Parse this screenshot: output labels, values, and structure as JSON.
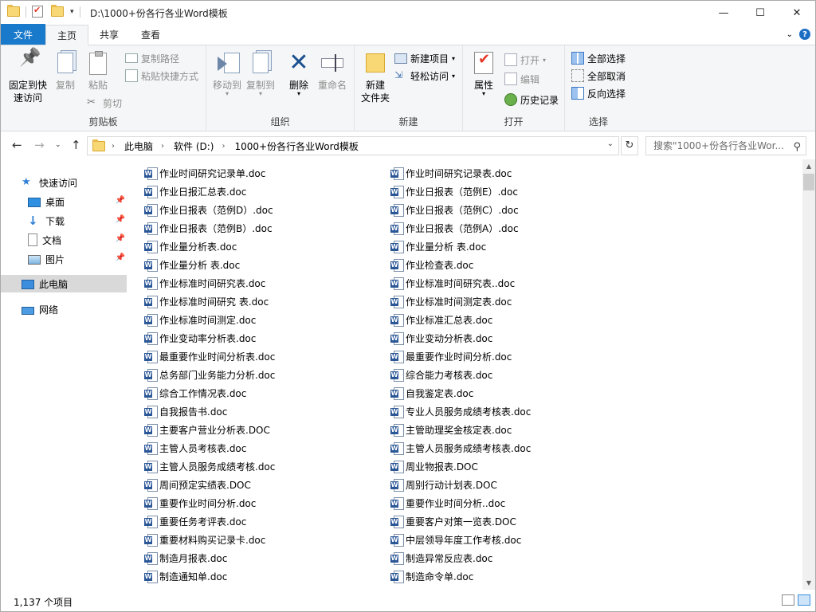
{
  "window": {
    "title": "D:\\1000+份各行各业Word模板",
    "controls": {
      "minimize": "—",
      "maximize": "☐",
      "close": "✕"
    }
  },
  "ribbon_tabs": [
    "文件",
    "主页",
    "共享",
    "查看"
  ],
  "ribbon": {
    "clipboard": {
      "label": "剪贴板",
      "pin": "固定到快\n速访问",
      "pin_l1": "固定到快",
      "pin_l2": "速访问",
      "copy": "复制",
      "paste": "粘贴",
      "copy_path": "复制路径",
      "paste_shortcut": "粘贴快捷方式",
      "cut": "剪切"
    },
    "organize": {
      "label": "组织",
      "move_to": "移动到",
      "copy_to": "复制到",
      "delete": "删除",
      "rename": "重命名"
    },
    "new": {
      "label": "新建",
      "new_folder_l1": "新建",
      "new_folder_l2": "文件夹",
      "new_item": "新建项目",
      "easy_access": "轻松访问"
    },
    "open": {
      "label": "打开",
      "properties": "属性",
      "open": "打开",
      "edit": "编辑",
      "history": "历史记录"
    },
    "select": {
      "label": "选择",
      "select_all": "全部选择",
      "select_none": "全部取消",
      "invert": "反向选择"
    }
  },
  "address": {
    "crumbs": [
      "此电脑",
      "软件 (D:)",
      "1000+份各行各业Word模板"
    ],
    "search_placeholder": "搜索\"1000+份各行各业Wor..."
  },
  "nav_pane": {
    "quick_access": "快速访问",
    "desktop": "桌面",
    "downloads": "下载",
    "documents": "文档",
    "pictures": "图片",
    "this_pc": "此电脑",
    "network": "网络"
  },
  "files_col1": [
    "作业时间研究记录单.doc",
    "作业日报汇总表.doc",
    "作业日报表（范例D）.doc",
    "作业日报表（范例B）.doc",
    "作业量分析表.doc",
    "作业量分析  表.doc",
    "作业标准时间研究表.doc",
    "作业标准时间研究 表.doc",
    "作业标准时间测定.doc",
    "作业变动率分析表.doc",
    "最重要作业时间分析表.doc",
    "总务部门业务能力分析.doc",
    "综合工作情况表.doc",
    "自我报告书.doc",
    "主要客户营业分析表.DOC",
    "主管人员考核表.doc",
    "主管人员服务成绩考核.doc",
    "周间预定实绩表.DOC",
    "重要作业时间分析.doc",
    "重要任务考评表.doc",
    "重要材料购买记录卡.doc",
    "制造月报表.doc",
    "制造通知单.doc"
  ],
  "files_col2": [
    "作业时间研究记录表.doc",
    "作业日报表（范例E）.doc",
    "作业日报表（范例C）.doc",
    "作业日报表（范例A）.doc",
    "作业量分析 表.doc",
    "作业检查表.doc",
    "作业标准时间研究表..doc",
    "作业标准时间测定表.doc",
    "作业标准汇总表.doc",
    "作业变动分析表.doc",
    "最重要作业时间分析.doc",
    "综合能力考核表.doc",
    "自我鉴定表.doc",
    "专业人员服务成绩考核表.doc",
    "主管助理奖金核定表.doc",
    "主管人员服务成绩考核表.doc",
    "周业物报表.DOC",
    "周别行动计划表.DOC",
    "重要作业时间分析..doc",
    "重要客户对策一览表.DOC",
    "中层领导年度工作考核.doc",
    "制造异常反应表.doc",
    "制造命令单.doc"
  ],
  "status": {
    "item_count": "1,137 个项目"
  }
}
